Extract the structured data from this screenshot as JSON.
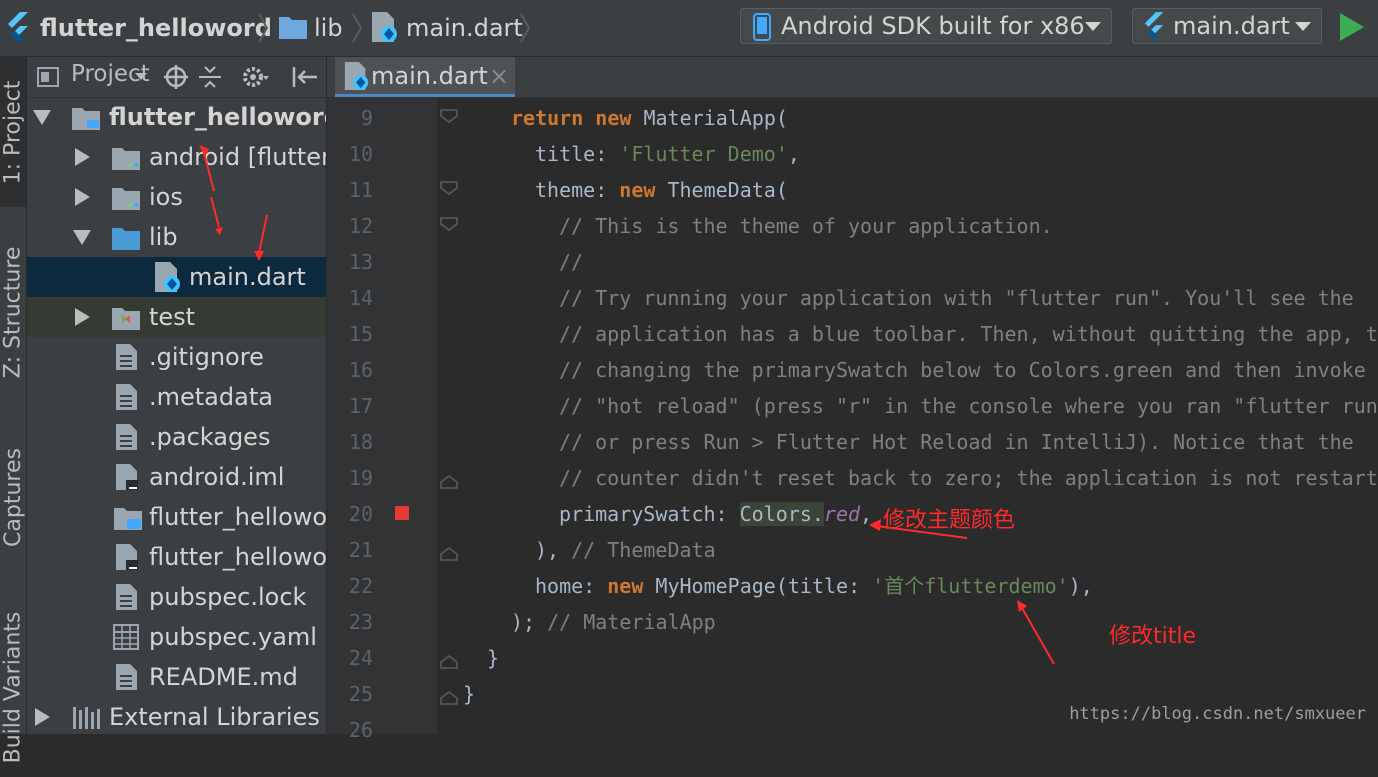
{
  "breadcrumb": {
    "project": "flutter_helloword",
    "folder": "lib",
    "file": "main.dart"
  },
  "device_selector": {
    "label": "Android SDK built for x86",
    "icon": "phone-icon"
  },
  "run_config": {
    "label": "main.dart",
    "icon": "flutter-icon"
  },
  "run_button": {
    "icon": "run-triangle-icon",
    "color": "#3dad53"
  },
  "left_tabs": [
    "1: Project",
    "Z: Structure",
    "Captures",
    "Build Variants"
  ],
  "project_panel": {
    "dropdown_label": "Project",
    "tree": [
      {
        "label": "flutter_helloword",
        "bold": true,
        "expanded": true,
        "icon": "module-folder-icon"
      },
      {
        "label": "android [flutter",
        "bold_suffix": "[flutter",
        "icon": "folder-icon"
      },
      {
        "label": "ios",
        "icon": "folder-icon"
      },
      {
        "label": "lib",
        "expanded": true,
        "icon": "source-folder-icon"
      },
      {
        "label": "main.dart",
        "selected": true,
        "icon": "dart-file-icon"
      },
      {
        "label": "test",
        "icon": "test-folder-icon"
      },
      {
        "label": ".gitignore",
        "icon": "text-file-icon"
      },
      {
        "label": ".metadata",
        "icon": "text-file-icon"
      },
      {
        "label": ".packages",
        "icon": "text-file-icon"
      },
      {
        "label": "android.iml",
        "icon": "iml-file-icon"
      },
      {
        "label": "flutter_hellowor",
        "icon": "module-file-icon"
      },
      {
        "label": "flutter_hellowor",
        "icon": "iml-file-icon"
      },
      {
        "label": "pubspec.lock",
        "icon": "text-file-icon"
      },
      {
        "label": "pubspec.yaml",
        "icon": "yaml-file-icon"
      },
      {
        "label": "README.md",
        "icon": "text-file-icon"
      },
      {
        "label": "External Libraries",
        "icon": "library-icon"
      }
    ]
  },
  "editor_tab": {
    "label": "main.dart",
    "close": "×"
  },
  "code_lines": [
    {
      "n": "9",
      "html_key": "l9"
    },
    {
      "n": "10"
    },
    {
      "n": "11"
    },
    {
      "n": "12"
    },
    {
      "n": "13"
    },
    {
      "n": "14"
    },
    {
      "n": "15"
    },
    {
      "n": "16"
    },
    {
      "n": "17"
    },
    {
      "n": "18"
    },
    {
      "n": "19"
    },
    {
      "n": "20"
    },
    {
      "n": "21"
    },
    {
      "n": "22"
    },
    {
      "n": "23"
    },
    {
      "n": "24"
    },
    {
      "n": "25"
    },
    {
      "n": "26"
    }
  ],
  "code": {
    "l9_kw1": "return",
    "l9_kw2": "new",
    "l9_rest": " MaterialApp(",
    "l10_prop": "title: ",
    "l10_str": "'Flutter Demo'",
    "l10_end": ",",
    "l11_prop": "theme: ",
    "l11_kw": "new",
    "l11_rest": " ThemeData(",
    "l12": "// This is the theme of your application.",
    "l13": "//",
    "l14": "// Try running your application with \"flutter run\". You'll see the",
    "l15": "// application has a blue toolbar. Then, without quitting the app, try",
    "l16": "// changing the primarySwatch below to Colors.green and then invoke",
    "l17": "// \"hot reload\" (press \"r\" in the console where you ran \"flutter run\",",
    "l18": "// or press Run > Flutter Hot Reload in IntelliJ). Notice that the",
    "l19": "// counter didn't reset back to zero; the application is not restarted.",
    "l20_prop": "primarySwatch: ",
    "l20_cls": "Colors.",
    "l20_val": "red",
    "l20_end": ",",
    "l21_code": "), ",
    "l21_cm": "// ThemeData",
    "l22_prop": "home: ",
    "l22_kw": "new",
    "l22_mid": " MyHomePage(title: ",
    "l22_str": "'首个flutterdemo'",
    "l22_end": "),",
    "l23_code": ");",
    "l23_cm": " // MaterialApp",
    "l24": "}",
    "l25": "}"
  },
  "annotations": {
    "theme_color": "修改主题颜色",
    "title": "修改title"
  },
  "watermark": "https://blog.csdn.net/smxueer",
  "colors": {
    "annotation": "#ff2a2a",
    "breakpoint": "#e53935",
    "keyword": "#cc7832",
    "string": "#6a8759",
    "comment": "#808080"
  }
}
